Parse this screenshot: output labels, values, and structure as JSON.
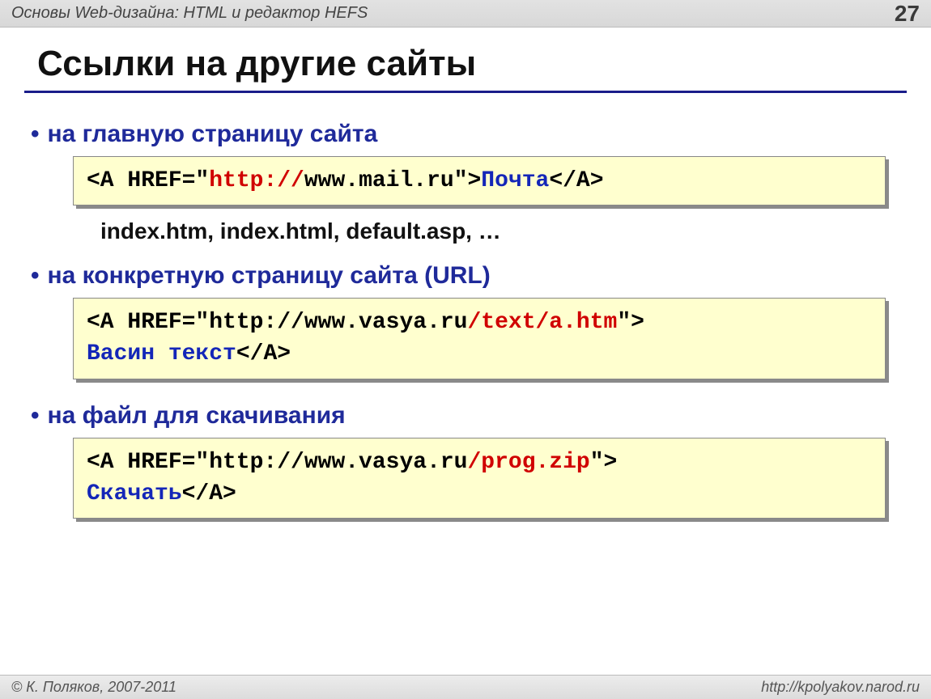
{
  "header": {
    "course_title": "Основы Web-дизайна: HTML и редактор HEFS",
    "page_number": "27"
  },
  "title": "Ссылки на другие сайты",
  "bullets": {
    "b1": "на главную страницу сайта",
    "b2": "на конкретную страницу сайта (URL)",
    "b3": "на файл для скачивания"
  },
  "code1": {
    "p1": "<A HREF=\"",
    "p2": "http://",
    "p3": "www.mail.ru\">",
    "p4": "Почта",
    "p5": "</A>"
  },
  "index_line": "index.htm, index.html, default.asp, …",
  "code2": {
    "p1": "<A HREF=\"http://www.vasya.ru",
    "p2": "/text/a.htm",
    "p3": "\">",
    "p4": "Васин текст",
    "p5": "</A>"
  },
  "code3": {
    "p1": "<A HREF=\"http://www.vasya.ru",
    "p2": "/prog.zip",
    "p3": "\">",
    "p4": "Скачать",
    "p5": "</A>"
  },
  "footer": {
    "copyright": "© К. Поляков, 2007-2011",
    "url": "http://kpolyakov.narod.ru"
  }
}
